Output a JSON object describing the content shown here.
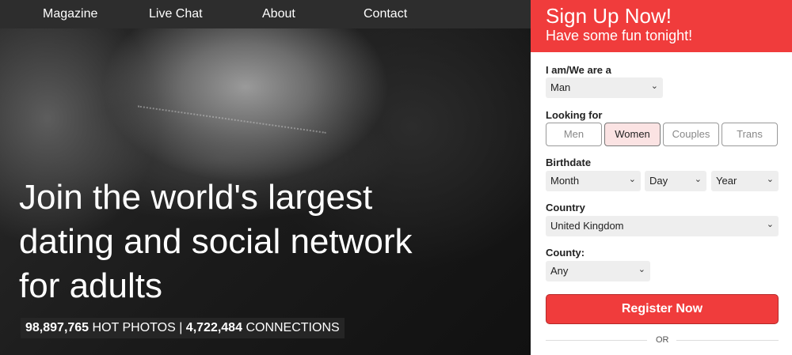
{
  "nav": {
    "items": [
      "Magazine",
      "Live Chat",
      "About",
      "Contact"
    ]
  },
  "hero": {
    "headline_line1": "Join the world's largest",
    "headline_line2": "dating and social network",
    "headline_line3": "for adults",
    "stats": {
      "photos_count": "98,897,765",
      "photos_label": "HOT PHOTOS",
      "separator": "|",
      "connections_count": "4,722,484",
      "connections_label": "CONNECTIONS"
    }
  },
  "signup": {
    "title": "Sign Up Now!",
    "subtitle": "Have some fun tonight!",
    "iam_label": "I am/We are a",
    "iam_value": "Man",
    "looking_label": "Looking for",
    "looking_options": [
      "Men",
      "Women",
      "Couples",
      "Trans"
    ],
    "looking_selected": "Women",
    "birthdate_label": "Birthdate",
    "month_value": "Month",
    "day_value": "Day",
    "year_value": "Year",
    "country_label": "Country",
    "country_value": "United Kingdom",
    "county_label": "County:",
    "county_value": "Any",
    "register_label": "Register Now",
    "or_label": "OR"
  },
  "colors": {
    "accent": "#f03c3c",
    "nav_bg": "#2d2d2d"
  },
  "icons": {
    "select_caret": "chevron-down-icon"
  }
}
